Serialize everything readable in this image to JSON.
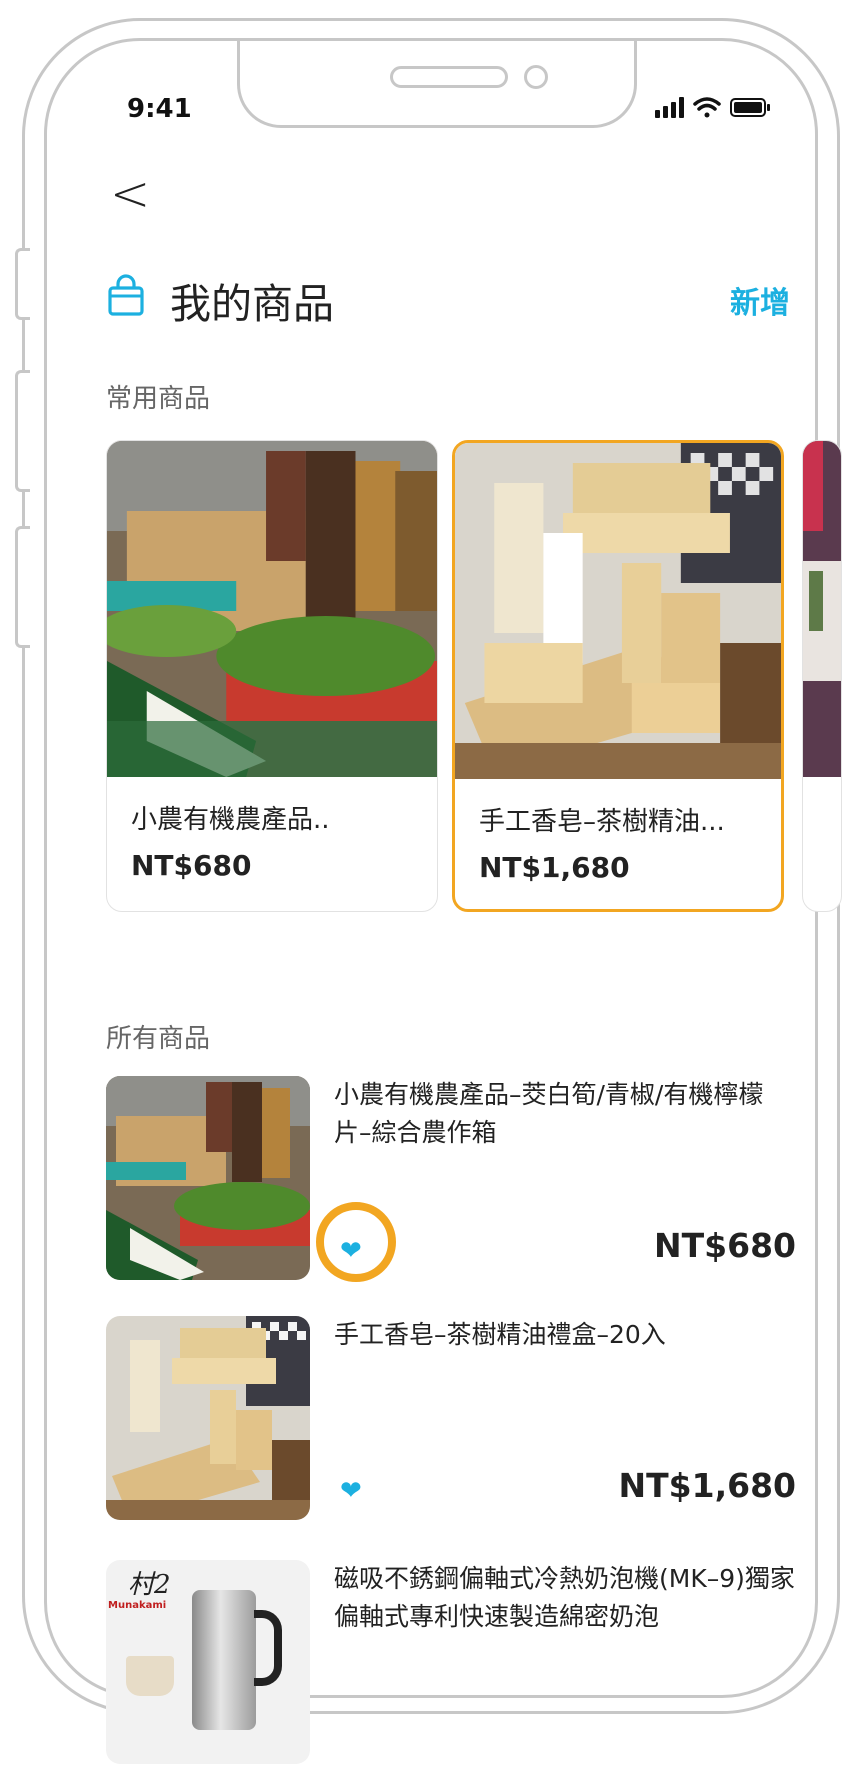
{
  "status_bar": {
    "time": "9:41"
  },
  "header": {
    "back_label": "<",
    "title": "我的商品",
    "add_label": "新增"
  },
  "frequent_section": {
    "label": "常用商品",
    "cards": [
      {
        "name": "小農有機農產品..",
        "price": "NT$680"
      },
      {
        "name": "手工香皂–茶樹精油...",
        "price": "NT$1,680"
      }
    ]
  },
  "all_section": {
    "label": "所有商品",
    "items": [
      {
        "name": "小農有機農產品–茭白筍/青椒/有機檸檬片–綜合農作箱",
        "price": "NT$680",
        "favorite": true
      },
      {
        "name": "手工香皂–茶樹精油禮盒–20入",
        "price": "NT$1,680",
        "favorite": true
      },
      {
        "name": "磁吸不銹鋼偏軸式冷熱奶泡機(MK–9)獨家偏軸式專利快速製造綿密奶泡",
        "thumb_logo": "Munakami",
        "thumb_mark": "村2"
      }
    ]
  },
  "colors": {
    "accent": "#1cb0e0",
    "highlight": "#f2a621",
    "text": "#222222",
    "muted": "#666666"
  }
}
